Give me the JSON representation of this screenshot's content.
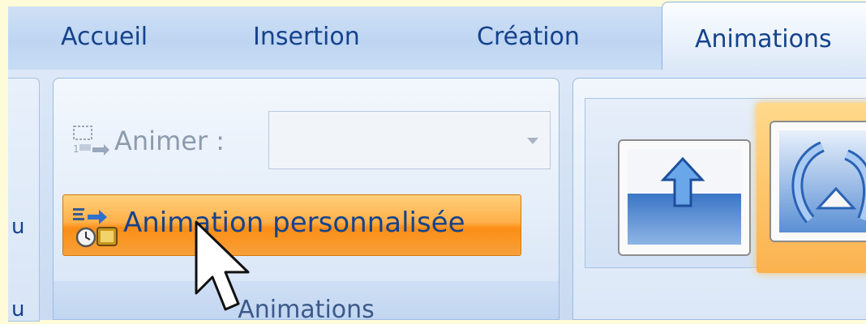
{
  "tabs": {
    "home": "Accueil",
    "insert": "Insertion",
    "design": "Création",
    "animations": "Animations"
  },
  "animations_group": {
    "animate_label": "Animer :",
    "animate_value": "",
    "custom_animation_label": "Animation personnalisée",
    "group_label": "Animations"
  },
  "left_group": {
    "fragment_1": "u",
    "fragment_2": "u"
  },
  "colors": {
    "accent_blue": "#15428b",
    "highlight_orange": "#fb8e16",
    "background_yellow": "#fefbd8"
  },
  "icons": {
    "animate": "animate-icon",
    "custom_animation": "custom-animation-icon",
    "dropdown": "dropdown-arrow-icon",
    "cursor": "mouse-cursor-icon"
  }
}
